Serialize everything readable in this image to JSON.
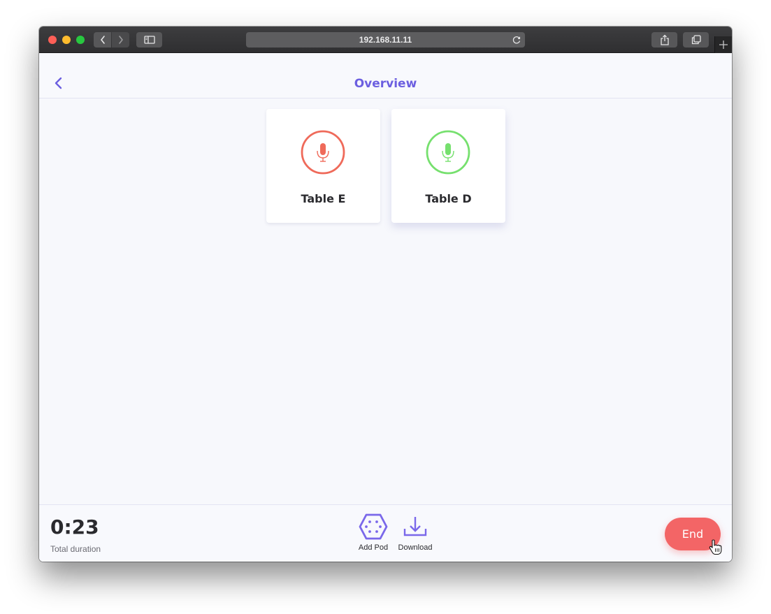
{
  "browser": {
    "url": "192.168.11.11",
    "icons": {
      "back": "chevron-left-icon",
      "forward": "chevron-right-icon",
      "sidebar": "sidebar-icon",
      "reload": "reload-icon",
      "share": "share-icon",
      "tabs": "tabs-icon",
      "new_tab": "plus-icon"
    }
  },
  "header": {
    "title": "Overview",
    "back_icon": "chevron-left-icon"
  },
  "tables": [
    {
      "label": "Table E",
      "icon": "microphone-icon",
      "status_color": "#ef6a5a"
    },
    {
      "label": "Table D",
      "icon": "microphone-icon",
      "status_color": "#76e06e"
    }
  ],
  "footer": {
    "duration": "0:23",
    "duration_label": "Total duration",
    "actions": [
      {
        "label": "Add Pod",
        "icon": "hexagon-pod-icon"
      },
      {
        "label": "Download",
        "icon": "download-icon"
      }
    ],
    "end_label": "End"
  },
  "colors": {
    "accent": "#6c5fe0",
    "end_button": "#f36566"
  }
}
